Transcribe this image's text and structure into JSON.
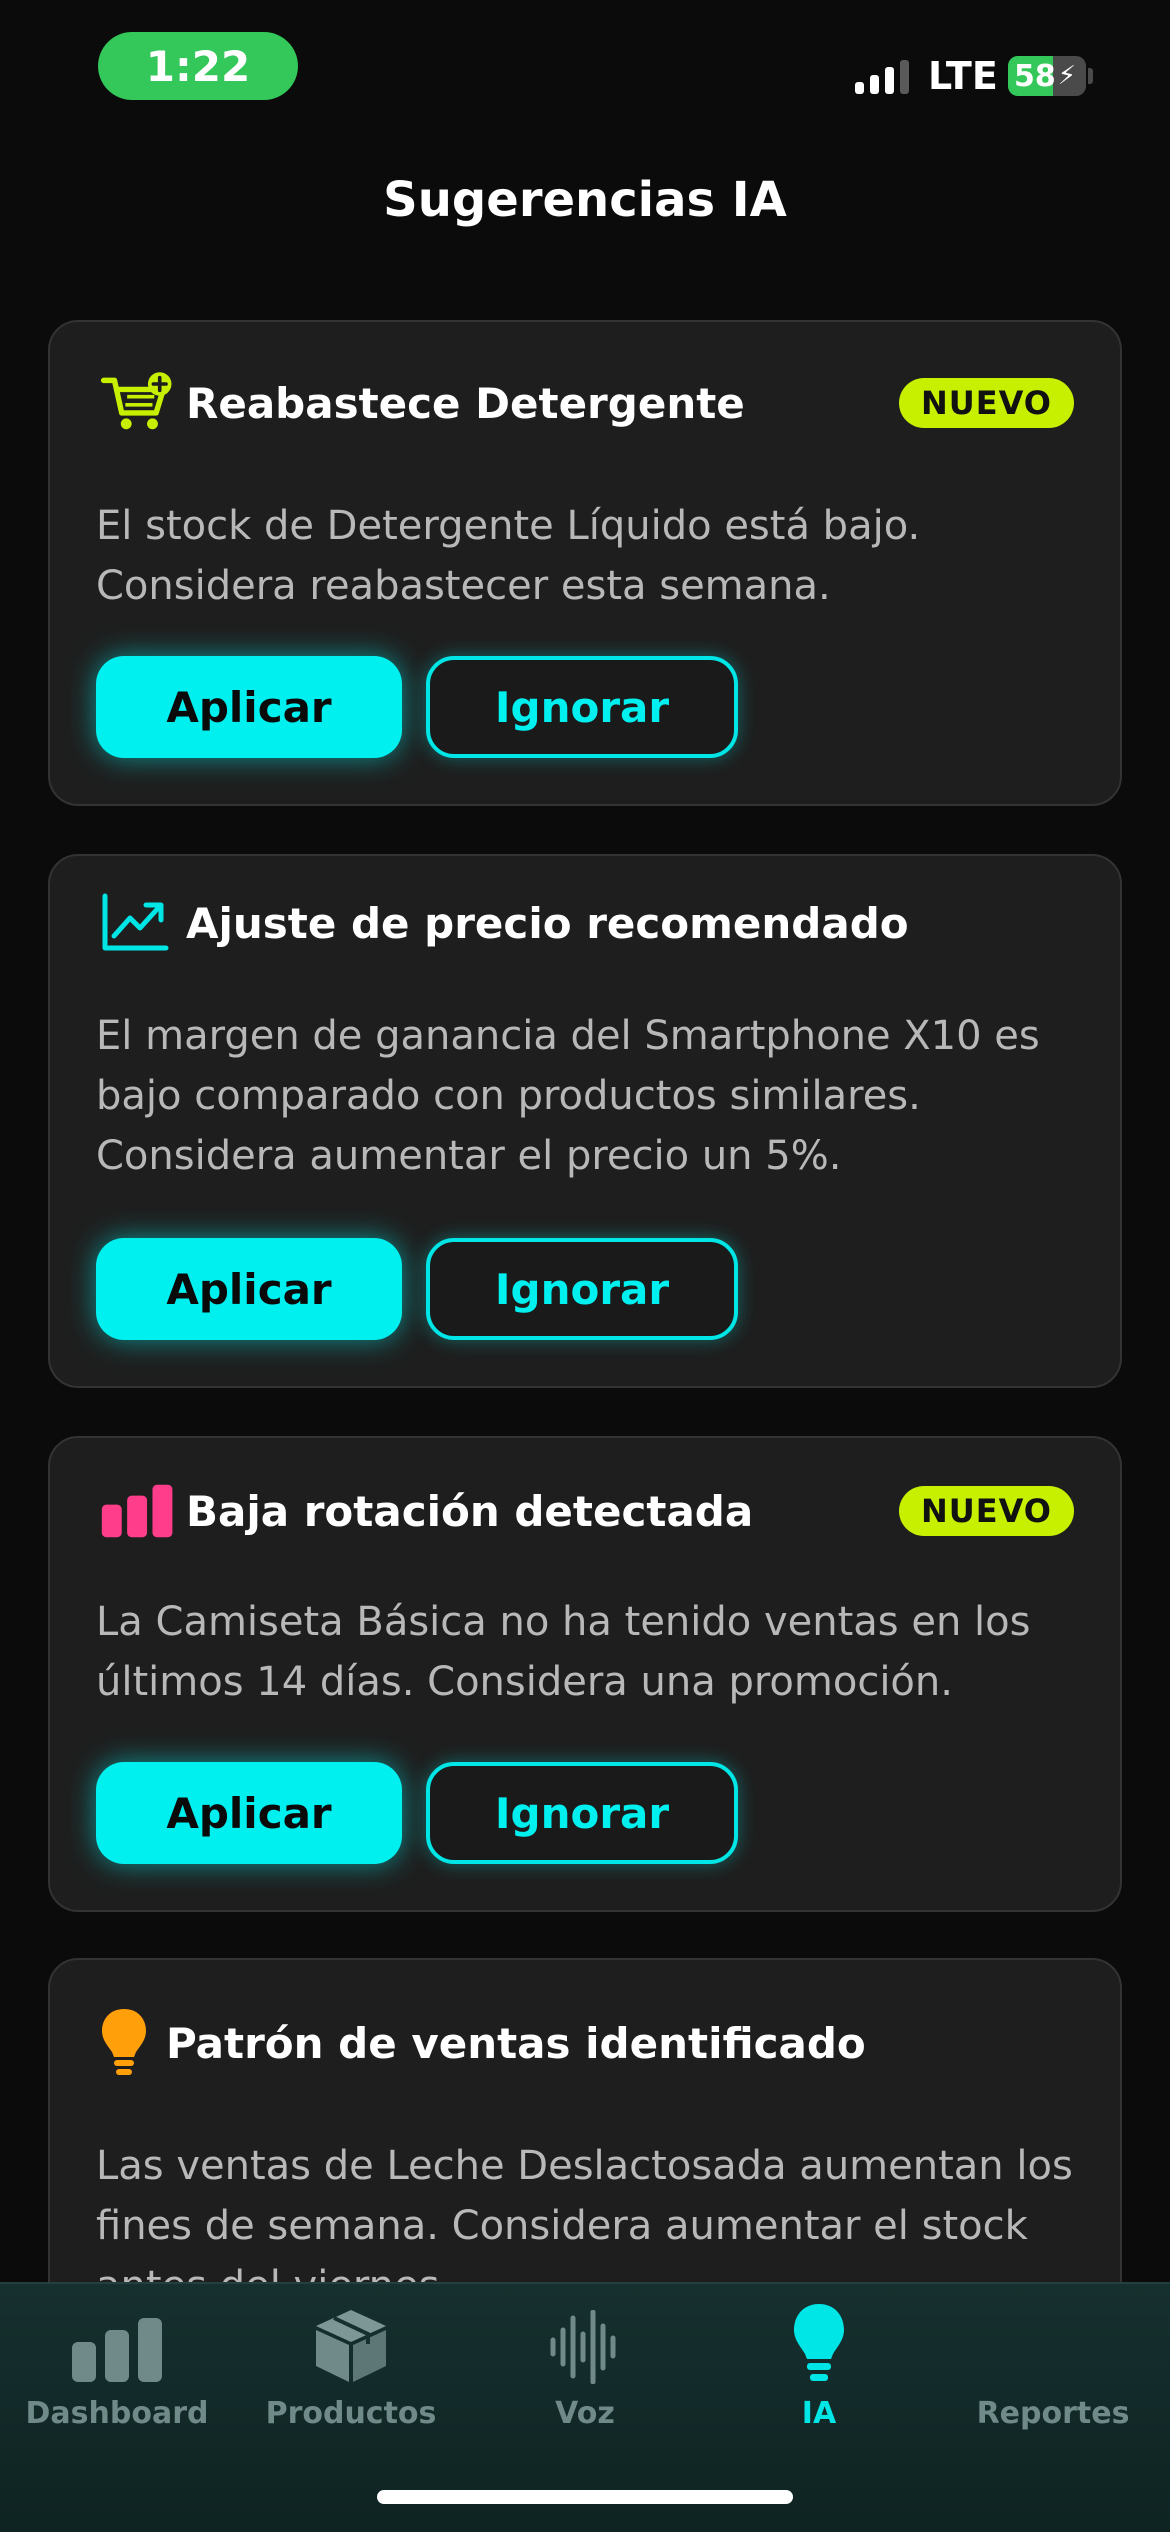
{
  "status_bar": {
    "time": "1:22",
    "network": "LTE",
    "battery": "58",
    "battery_level": 0.58
  },
  "header": {
    "title": "Sugerencias IA"
  },
  "colors": {
    "accent": "#00f0f0",
    "badge": "#c6f000",
    "cart_icon": "#c6f000",
    "chart_icon": "#00e5e5",
    "bars_icon": "#ff3d8b",
    "bulb_icon": "#ff9f0a"
  },
  "cards": [
    {
      "icon": "cart-plus-icon",
      "title": "Reabastece Detergente",
      "badge": "NUEVO",
      "body": "El stock de Detergente Líquido está bajo. Considera reabastecer esta semana.",
      "apply_label": "Aplicar",
      "ignore_label": "Ignorar"
    },
    {
      "icon": "trending-up-icon",
      "title": "Ajuste de precio recomendado",
      "body": "El margen de ganancia del Smartphone X10 es bajo comparado con productos similares. Considera aumentar el precio un 5%.",
      "apply_label": "Aplicar",
      "ignore_label": "Ignorar"
    },
    {
      "icon": "bar-chart-icon",
      "title": "Baja rotación detectada",
      "badge": "NUEVO",
      "body": "La Camiseta Básica no ha tenido ventas en los últimos 14 días. Considera una promoción.",
      "apply_label": "Aplicar",
      "ignore_label": "Ignorar"
    },
    {
      "icon": "lightbulb-icon",
      "title": "Patrón de ventas identificado",
      "body": "Las ventas de Leche Deslactosada aumentan los fines de semana. Considera aumentar el stock antes del viernes."
    }
  ],
  "tab_bar": {
    "tabs": [
      {
        "label": "Dashboard",
        "icon": "bar-chart-icon"
      },
      {
        "label": "Productos",
        "icon": "box-icon"
      },
      {
        "label": "Voz",
        "icon": "waveform-icon"
      },
      {
        "label": "IA",
        "icon": "lightbulb-icon",
        "active": true
      },
      {
        "label": "Reportes",
        "icon": "document-icon"
      }
    ]
  }
}
